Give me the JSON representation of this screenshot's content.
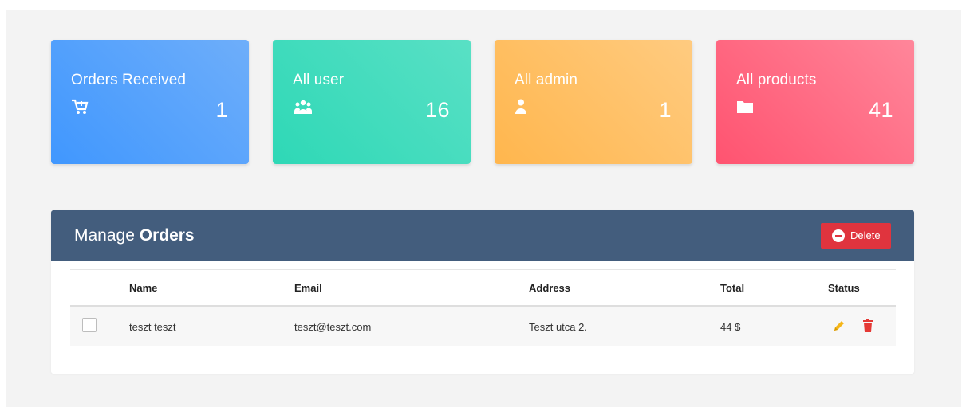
{
  "stats": [
    {
      "title": "Orders Received",
      "value": "1",
      "icon": "cart-icon",
      "gradient": [
        "#4097fe",
        "#6eaefa"
      ]
    },
    {
      "title": "All user",
      "value": "16",
      "icon": "users-icon",
      "gradient": [
        "#2ed8b6",
        "#59e0c5"
      ]
    },
    {
      "title": "All admin",
      "value": "1",
      "icon": "user-icon",
      "gradient": [
        "#ffb64d",
        "#ffcb80"
      ]
    },
    {
      "title": "All products",
      "value": "41",
      "icon": "folder-icon",
      "gradient": [
        "#ff5370",
        "#ff869a"
      ]
    }
  ],
  "panel": {
    "title_light": "Manage",
    "title_bold": "Orders",
    "delete_label": "Delete",
    "header_color": "#435d7d",
    "delete_color": "#e0343e"
  },
  "table": {
    "columns": [
      "Name",
      "Email",
      "Address",
      "Total",
      "Status"
    ],
    "rows": [
      {
        "name": "teszt teszt",
        "email": "teszt@teszt.com",
        "address": "Teszt utca 2.",
        "total": "44 $"
      }
    ],
    "edit_icon": "pencil-icon",
    "delete_icon": "trash-icon",
    "edit_color": "#f5b619",
    "delete_color": "#e53935"
  }
}
